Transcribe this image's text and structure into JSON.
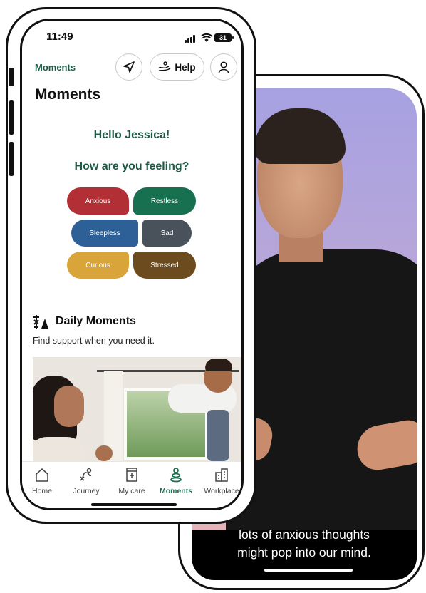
{
  "video": {
    "caption_lines": [
      "lots of anxious thoughts",
      "might pop into our mind."
    ]
  },
  "status_bar": {
    "time": "11:49",
    "battery": "31"
  },
  "header": {
    "breadcrumb": "Moments",
    "help_label": "Help",
    "icons": [
      "send-icon",
      "help-icon",
      "profile-icon"
    ]
  },
  "page": {
    "title": "Moments",
    "greeting": "Hello Jessica!",
    "question": "How are you feeling?"
  },
  "moods": [
    {
      "label": "Anxious",
      "color": "#b22f35"
    },
    {
      "label": "Restless",
      "color": "#17704f"
    },
    {
      "label": "Sleepless",
      "color": "#2d6096"
    },
    {
      "label": "Sad",
      "color": "#49515a"
    },
    {
      "label": "Curious",
      "color": "#d9a53b"
    },
    {
      "label": "Stressed",
      "color": "#6c4b1e"
    }
  ],
  "daily_moments": {
    "title": "Daily Moments",
    "subtitle": "Find support when you need it."
  },
  "tab_bar": {
    "active": "Moments",
    "tabs": [
      {
        "label": "Home",
        "icon": "home-icon"
      },
      {
        "label": "Journey",
        "icon": "journey-icon"
      },
      {
        "label": "My care",
        "icon": "my-care-icon"
      },
      {
        "label": "Moments",
        "icon": "moments-icon"
      },
      {
        "label": "Workplace",
        "icon": "workplace-icon"
      }
    ]
  },
  "colors": {
    "brand_green": "#1c5a45",
    "active_tab": "#17704f"
  }
}
